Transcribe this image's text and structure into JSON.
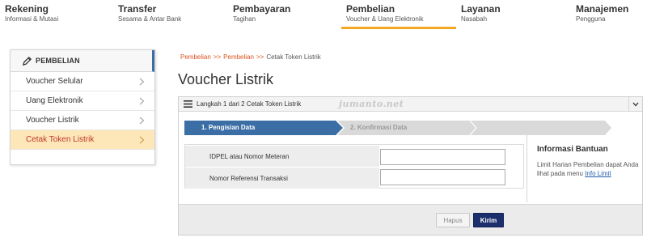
{
  "nav": {
    "items": [
      {
        "title": "Rekening",
        "subtitle": "Informasi & Mutasi"
      },
      {
        "title": "Transfer",
        "subtitle": "Sesama & Antar Bank"
      },
      {
        "title": "Pembayaran",
        "subtitle": "Tagihan"
      },
      {
        "title": "Pembelian",
        "subtitle": "Voucher & Uang Elektronik"
      },
      {
        "title": "Layanan",
        "subtitle": "Nasabah"
      },
      {
        "title": "Manajemen",
        "subtitle": "Pengguna"
      }
    ],
    "active_index": 3,
    "accent_color": "#f5a623"
  },
  "sidebar": {
    "header": "PEMBELIAN",
    "items": [
      {
        "label": "Voucher Selular"
      },
      {
        "label": "Uang Elektronik"
      },
      {
        "label": "Voucher Listrik"
      },
      {
        "label": "Cetak Token Listrik"
      }
    ],
    "active_index": 3
  },
  "breadcrumb": {
    "items": [
      "Pembelian",
      "Pembelian",
      "Cetak Token Listrik"
    ],
    "separator": ">>"
  },
  "page_title": "Voucher Listrik",
  "panel": {
    "step_label": "Langkah 1 dari 2 Cetak Token Listrik",
    "watermark": "jumanto.net",
    "steps": [
      "1. Pengisian Data",
      "2. Konfirmasi Data"
    ],
    "active_step_color": "#3a6ea5",
    "fields": [
      {
        "label": "IDPEL atau Nomor Meteran",
        "value": ""
      },
      {
        "label": "Nomor Referensi Transaksi",
        "value": ""
      }
    ],
    "info": {
      "heading": "Informasi Bantuan",
      "body": "Limit Harian Pembelian dapat Anda lihat pada menu",
      "link": "Info Limit"
    },
    "buttons": {
      "reset": "Hapus",
      "submit": "Kirim"
    }
  }
}
